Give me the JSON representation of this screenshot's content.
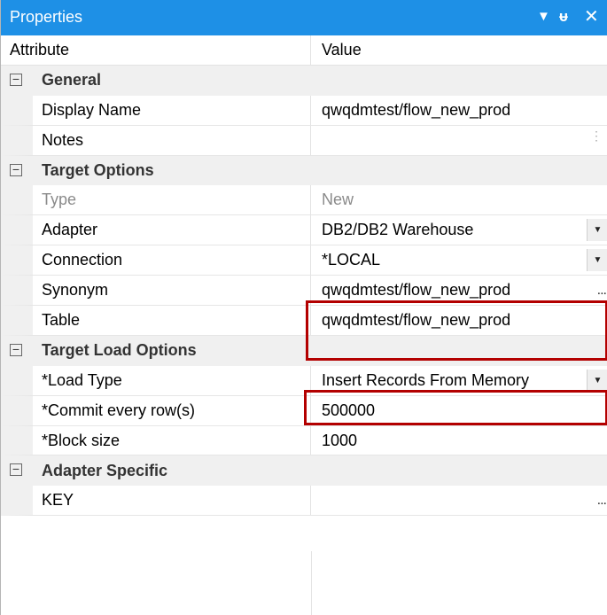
{
  "window": {
    "title": "Properties",
    "dropdown_icon": "▼",
    "pin_icon": "ᵾ",
    "close_icon": "✕"
  },
  "header": {
    "attribute": "Attribute",
    "value": "Value"
  },
  "groups": [
    {
      "name": "General",
      "toggle": "−"
    },
    {
      "name": "Target Options",
      "toggle": "−"
    },
    {
      "name": "Target Load Options",
      "toggle": "−"
    },
    {
      "name": "Adapter Specific",
      "toggle": "−"
    }
  ],
  "properties": {
    "display_name": {
      "label": "Display Name",
      "value": "qwqdmtest/flow_new_prod"
    },
    "notes": {
      "label": "Notes",
      "value": ""
    },
    "type": {
      "label": "Type",
      "value": "New"
    },
    "adapter": {
      "label": "Adapter",
      "value": "DB2/DB2 Warehouse"
    },
    "connection": {
      "label": "Connection",
      "value": "*LOCAL"
    },
    "synonym": {
      "label": "Synonym",
      "value": "qwqdmtest/flow_new_prod"
    },
    "table": {
      "label": "Table",
      "value": "qwqdmtest/flow_new_prod"
    },
    "load_type": {
      "label": "*Load Type",
      "value": "Insert Records From Memory"
    },
    "commit_rows": {
      "label": "*Commit every row(s)",
      "value": "500000"
    },
    "block_size": {
      "label": "*Block size",
      "value": "1000"
    },
    "key": {
      "label": "KEY",
      "value": ""
    }
  },
  "controls": {
    "ellipsis": "...",
    "dropdown_arrow": "▼",
    "grip": "⋮"
  },
  "colors": {
    "titlebar": "#1e90e6",
    "highlight": "#b30000",
    "group_bg": "#f0f0f0"
  }
}
